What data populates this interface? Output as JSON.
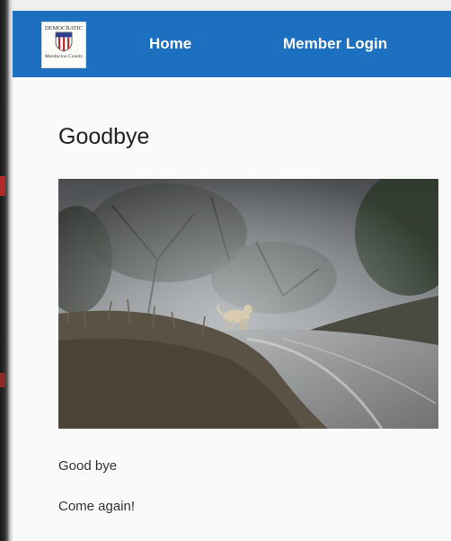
{
  "logo": {
    "top_text": "DEMOCRATIC",
    "bottom_text": "Mendocino County"
  },
  "nav": {
    "items": [
      {
        "label": "Home"
      },
      {
        "label": "Member Login"
      }
    ]
  },
  "page": {
    "title": "Goodbye",
    "paragraphs": [
      "Good bye",
      "Come again!"
    ]
  },
  "colors": {
    "navbar": "#1d6fbf",
    "nav_text": "#ffffff",
    "background": "#fafafa"
  }
}
